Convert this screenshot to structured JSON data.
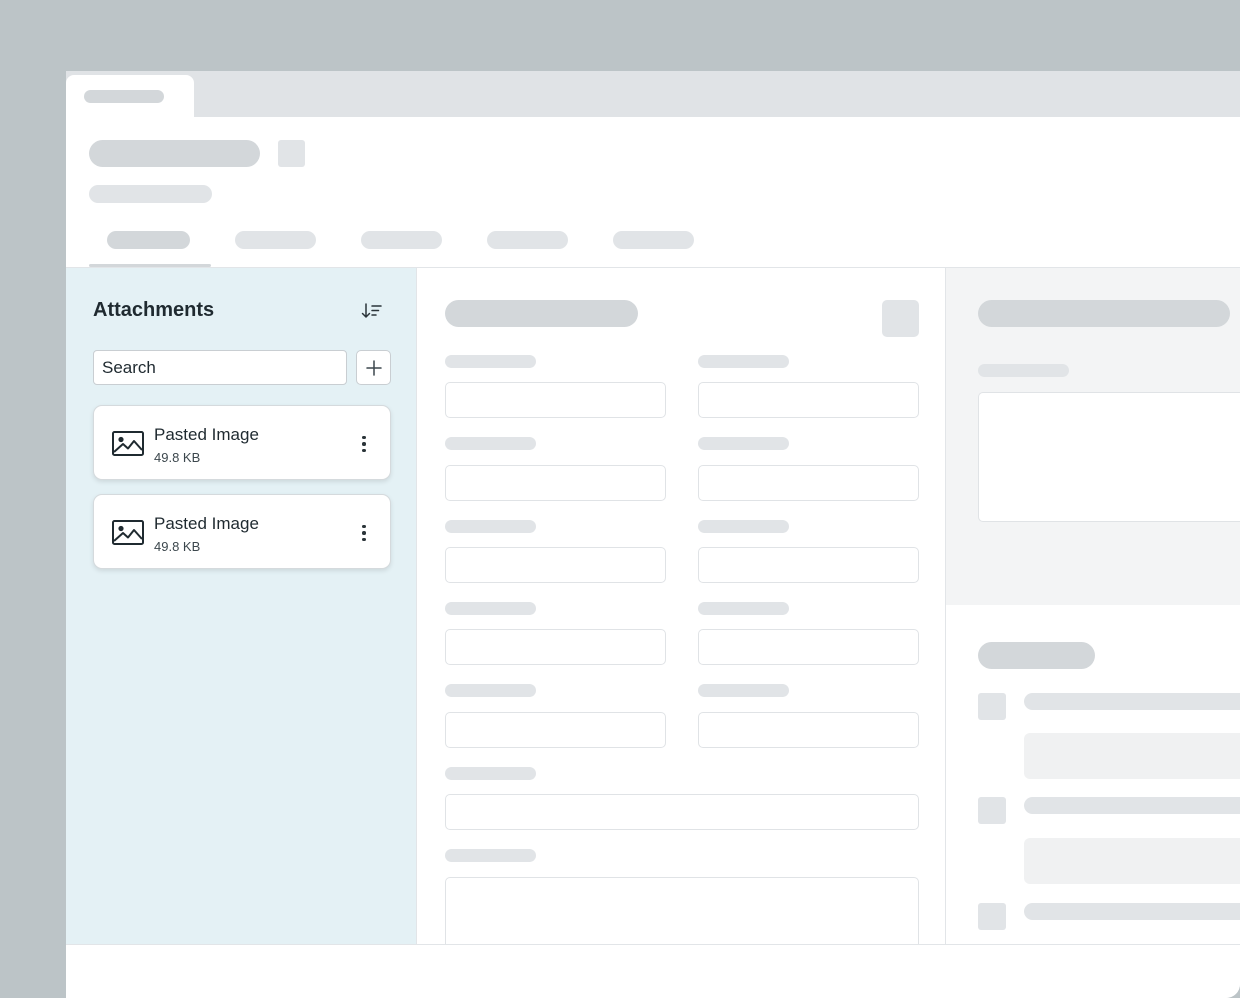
{
  "attachments": {
    "title": "Attachments",
    "search_placeholder": "Search",
    "items": [
      {
        "name": "Pasted Image",
        "size": "49.8 KB"
      },
      {
        "name": "Pasted Image",
        "size": "49.8 KB"
      }
    ]
  },
  "icons": {
    "sort": "sort-descending-icon",
    "add": "plus-icon",
    "image": "image-icon",
    "more": "more-vertical-icon"
  },
  "colors": {
    "panel_bg": "#e4f1f5",
    "skeleton": "#d3d7da",
    "backdrop": "#bcc4c7"
  }
}
